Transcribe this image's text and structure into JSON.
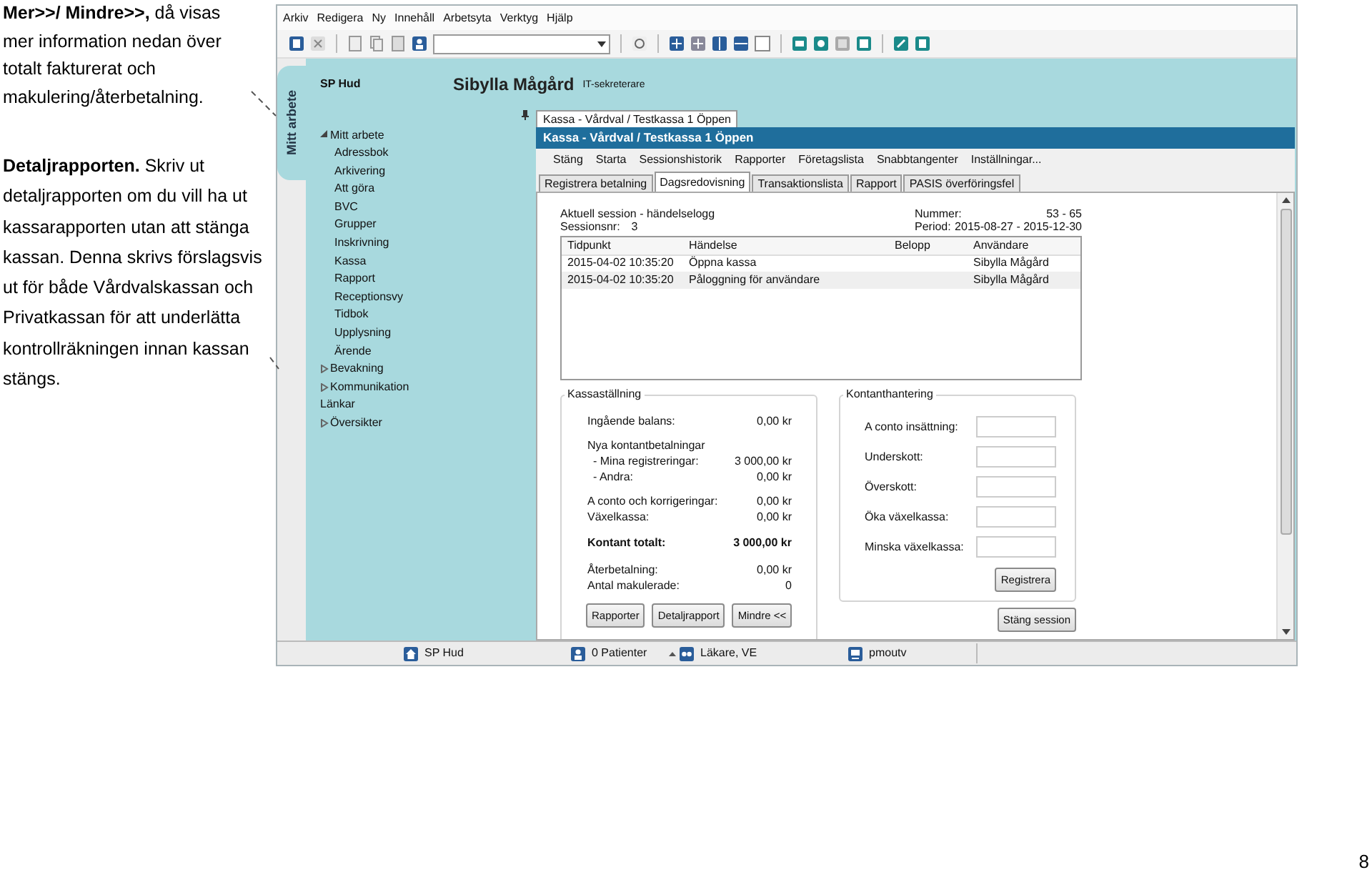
{
  "notes": [
    {
      "text": "**Mer>>/ Mindre>>,** då visas mer information nedan över totalt fakturerat och makulering/återbetalning."
    },
    {
      "text": "**Detaljrapporten.** Skriv ut detaljrapporten om du vill ha ut kassarapporten utan att stänga kassan. Denna skrivs förslagsvis ut för både Vårdvalskassan och Privatkassan för att underlätta kontrollräkningen innan kassan stängs."
    }
  ],
  "app": {
    "menu": [
      "Arkiv",
      "Redigera",
      "Ny",
      "Innehåll",
      "Arbetsyta",
      "Verktyg",
      "Hjälp"
    ],
    "side_tab": "Mitt arbete",
    "unit": "SP Hud",
    "user": {
      "name": "Sibylla Mågård",
      "role": "IT-sekreterare"
    },
    "tree": [
      {
        "label": "Mitt arbete",
        "kind": "group",
        "expanded": true,
        "children": [
          {
            "label": "Adressbok"
          },
          {
            "label": "Arkivering"
          },
          {
            "label": "Att göra"
          },
          {
            "label": "BVC"
          },
          {
            "label": "Grupper"
          },
          {
            "label": "Inskrivning"
          },
          {
            "label": "Kassa"
          },
          {
            "label": "Rapport"
          },
          {
            "label": "Receptionsvy"
          },
          {
            "label": "Tidbok"
          },
          {
            "label": "Upplysning"
          },
          {
            "label": "Ärende"
          }
        ]
      },
      {
        "label": "Bevakning",
        "kind": "group",
        "expanded": false
      },
      {
        "label": "Kommunikation",
        "kind": "group",
        "expanded": false
      },
      {
        "label": "Länkar",
        "kind": "leaf"
      },
      {
        "label": "Översikter",
        "kind": "group",
        "expanded": false
      }
    ],
    "kassa": {
      "window_tab": "Kassa - Vårdval / Testkassa 1 Öppen",
      "title": "Kassa - Vårdval / Testkassa 1 Öppen",
      "menu": [
        "Stäng",
        "Starta",
        "Sessionshistorik",
        "Rapporter",
        "Företagslista",
        "Snabbtangenter",
        "Inställningar..."
      ],
      "tabs": [
        {
          "label": "Registrera betalning",
          "selected": false
        },
        {
          "label": "Dagsredovisning",
          "selected": true
        },
        {
          "label": "Transaktionslista",
          "selected": false
        },
        {
          "label": "Rapport",
          "selected": false
        },
        {
          "label": "PASIS överföringsfel",
          "selected": false
        }
      ],
      "session": {
        "title": "Aktuell session - händelselogg",
        "session_label": "Sessionsnr:",
        "session_value": "3",
        "number_label": "Nummer:",
        "number_value": "53 - 65",
        "period_label": "Period:",
        "period_value": "2015-08-27 - 2015-12-30"
      },
      "log": {
        "columns": [
          "Tidpunkt",
          "Händelse",
          "Belopp",
          "Användare"
        ],
        "rows": [
          [
            "2015-04-02 10:35:20",
            "Öppna kassa",
            "",
            "Sibylla Mågård"
          ],
          [
            "2015-04-02 10:35:20",
            "Påloggning för användare",
            "",
            "Sibylla Mågård"
          ]
        ]
      },
      "cash": {
        "legend": "Kassaställning",
        "groups": [
          [
            {
              "kind": "item",
              "label": "Ingående balans:",
              "value": "0,00 kr"
            }
          ],
          [
            {
              "kind": "heading",
              "label": "Nya kontantbetalningar"
            },
            {
              "kind": "subitem",
              "label": "- Mina registreringar:",
              "value": "3 000,00 kr"
            },
            {
              "kind": "subitem",
              "label": "- Andra:",
              "value": "0,00 kr"
            }
          ],
          [
            {
              "kind": "item",
              "label": "A conto och korrigeringar:",
              "value": "0,00 kr"
            },
            {
              "kind": "item",
              "label": "Växelkassa:",
              "value": "0,00 kr"
            }
          ],
          [
            {
              "kind": "total",
              "label": "Kontant totalt:",
              "value": "3 000,00 kr"
            }
          ],
          [
            {
              "kind": "item",
              "label": "Återbetalning:",
              "value": "0,00 kr"
            },
            {
              "kind": "item",
              "label": "Antal makulerade:",
              "value": "0"
            }
          ]
        ],
        "buttons": [
          "Rapporter",
          "Detaljrapport",
          "Mindre <<"
        ]
      },
      "handling": {
        "legend": "Kontanthantering",
        "fields": [
          {
            "label": "A conto insättning:"
          },
          {
            "label": "Underskott:"
          },
          {
            "label": "Överskott:"
          },
          {
            "label": "Öka växelkassa:"
          },
          {
            "label": "Minska växelkassa:"
          }
        ],
        "button": "Registrera"
      },
      "close_button": "Stäng session"
    },
    "status_bar": [
      "SP Hud",
      "0 Patienter",
      "Läkare, VE",
      "pmoutv"
    ]
  },
  "page_number": "8"
}
